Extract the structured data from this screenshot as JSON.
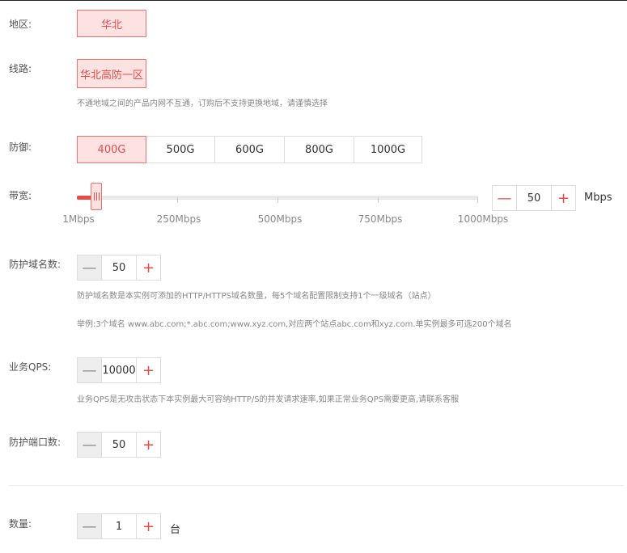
{
  "region": {
    "label": "地区:",
    "options": [
      "华北"
    ]
  },
  "line": {
    "label": "线路:",
    "options": [
      "华北高防一区"
    ],
    "hint": "不通地域之间的产品内网不互通，订购后不支持更换地域，请谨慎选择"
  },
  "defense": {
    "label": "防御:",
    "options": [
      "400G",
      "500G",
      "600G",
      "800G",
      "1000G"
    ],
    "selected": "400G"
  },
  "bandwidth": {
    "label": "带宽:",
    "ticks": [
      "1Mbps",
      "250Mbps",
      "500Mbps",
      "750Mbps",
      "1000Mbps"
    ],
    "min": 1,
    "max": 1000,
    "value": 50,
    "value_text": "50",
    "unit": "Mbps"
  },
  "domains": {
    "label": "防护域名数:",
    "value": "50",
    "hint1": "防护域名数是本实例可添加的HTTP/HTTPS域名数量，每5个域名配置限制支持1个一级域名（站点）",
    "hint2": "举例:3个域名 www.abc.com;*.abc.com;www.xyz.com,对应两个站点abc.com和xyz.com.单实例最多可选200个域名"
  },
  "qps": {
    "label": "业务QPS:",
    "value": "10000",
    "hint": "业务QPS是无攻击状态下本实例最大可容纳HTTP/S的并发请求速率,如果正常业务QPS需要更高,请联系客服"
  },
  "ports": {
    "label": "防护端口数:",
    "value": "50"
  },
  "quantity": {
    "label": "数量:",
    "value": "1",
    "unit": "台"
  },
  "colors": {
    "accent": "#e84a4a",
    "accent_bg": "#fde2e2",
    "border": "#dddddd"
  }
}
